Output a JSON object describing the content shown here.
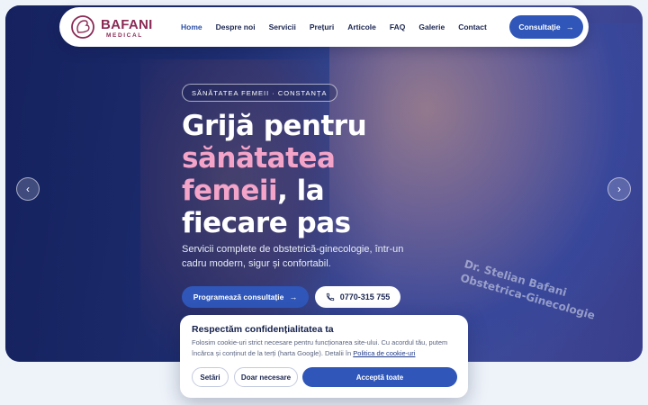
{
  "brand": {
    "name": "BAFANI",
    "sub": "MEDICAL",
    "color": "#8b2a55"
  },
  "nav": {
    "links": [
      {
        "label": "Home",
        "active": true
      },
      {
        "label": "Despre noi"
      },
      {
        "label": "Servicii"
      },
      {
        "label": "Prețuri"
      },
      {
        "label": "Articole"
      },
      {
        "label": "FAQ"
      },
      {
        "label": "Galerie"
      },
      {
        "label": "Contact"
      }
    ],
    "cta_label": "Consultație",
    "cta_icon": "arrow-right-icon"
  },
  "hero": {
    "tagline": "SĂNĂTATEA FEMEII · CONSTANȚA",
    "headline_part1": "Grijă pentru",
    "headline_pink1": "sănătatea",
    "headline_pink2": "femeii",
    "headline_part2": ", la",
    "headline_part3": "fiecare pas",
    "subtitle": "Servicii complete de obstetrică-ginecologie, într-un cadru modern, sigur și confortabil.",
    "primary_cta": "Programează consultație",
    "phone": "0770-315 755",
    "photo_text_line1": "Dr. Stelian Bafani",
    "photo_text_line2": "Obstetrica-Ginecologie",
    "prev_icon": "chevron-left-icon",
    "next_icon": "chevron-right-icon"
  },
  "cookie": {
    "title": "Respectăm confidențialitatea ta",
    "text": "Folosim cookie-uri strict necesare pentru funcționarea site-ului. Cu acordul tău, putem încărca și conținut de la terți (harta Google). Detalii în ",
    "link": "Politica de cookie-uri",
    "buttons": {
      "settings": "Setări",
      "necessary": "Doar necesare",
      "accept": "Acceptă toate"
    }
  },
  "colors": {
    "accent": "#2f56b8",
    "pink": "#f4a4c8",
    "dark": "#1a2550"
  }
}
